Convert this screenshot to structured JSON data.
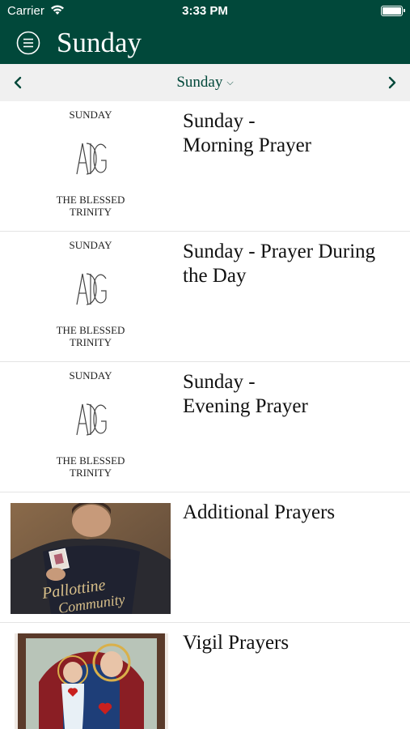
{
  "status_bar": {
    "carrier": "Carrier",
    "time": "3:33 PM"
  },
  "header": {
    "title": "Sunday",
    "menu_icon": "menu-icon"
  },
  "day_selector": {
    "selected": "Sunday",
    "prev_icon": "chevron-left-icon",
    "next_icon": "chevron-right-icon"
  },
  "items": [
    {
      "thumb_top": "SUNDAY",
      "thumb_bottom_1": "THE BLESSED",
      "thumb_bottom_2": "TRINITY",
      "title_1": "Sunday -",
      "title_2": "Morning Prayer"
    },
    {
      "thumb_top": "SUNDAY",
      "thumb_bottom_1": "THE BLESSED",
      "thumb_bottom_2": "TRINITY",
      "title_1": "Sunday - Prayer During",
      "title_2": "the Day"
    },
    {
      "thumb_top": "SUNDAY",
      "thumb_bottom_1": "THE BLESSED",
      "thumb_bottom_2": "TRINITY",
      "title_1": "Sunday -",
      "title_2": "Evening Prayer"
    },
    {
      "title_1": "Additional Prayers",
      "photo_caption": "Pallottine Community"
    },
    {
      "title_1": "Vigil Prayers"
    }
  ],
  "colors": {
    "brand": "#01483a",
    "daybar_bg": "#f0f0f0"
  }
}
